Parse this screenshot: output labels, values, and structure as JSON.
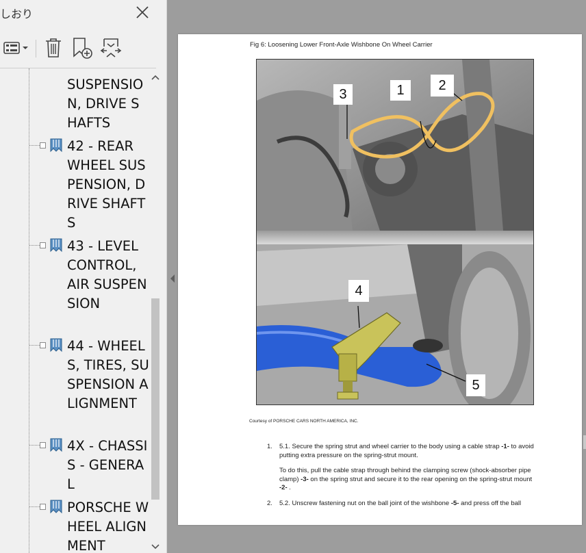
{
  "sidebar": {
    "title": "しおり",
    "toolbar": {
      "options_icon": "options-list-icon",
      "delete_icon": "trash-icon",
      "new_bookmark_icon": "new-bookmark-icon",
      "expand_icon": "expand-bookmark-icon"
    },
    "bookmarks": [
      {
        "label": "SUSPENSION, DRIVE SHAFTS",
        "expanded": false
      },
      {
        "label": "42 - REAR WHEEL SUSPENSION, DRIVE SHAFTS",
        "expanded": false
      },
      {
        "label": "43 - LEVEL CONTROL, AIR SUSPENSION",
        "expanded": false
      },
      {
        "label": "44 - WHEELS, TIRES, SUSPENSION ALIGNMENT",
        "expanded": false
      },
      {
        "label": "4X - CHASSIS - GENERAL",
        "expanded": false
      },
      {
        "label": "PORSCHE WHEEL ALIGNMENT",
        "expanded": false
      }
    ]
  },
  "document": {
    "figure_caption": "Fig 6: Loosening Lower Front-Axle Wishbone On Wheel Carrier",
    "callouts": [
      "1",
      "2",
      "3",
      "4",
      "5"
    ],
    "courtesy": "Courtesy of PORSCHE CARS NORTH AMERICA, INC.",
    "steps": [
      {
        "num": "1.",
        "text_a": "5.1. Secure the spring strut and wheel carrier to the body using a cable strap ",
        "ref_a": "-1-",
        "text_b": " to avoid putting extra pressure on the spring-strut mount.",
        "sub_a": "To do this, pull the cable strap through behind the clamping screw (shock-absorber pipe clamp) ",
        "sub_ref_a": "-3-",
        "sub_b": " on the spring strut and secure it to the rear opening on the spring-strut mount ",
        "sub_ref_b": "-2-",
        "sub_c": " ."
      },
      {
        "num": "2.",
        "text_a": "5.2. Unscrew fastening nut on the ball joint of the wishbone ",
        "ref_a": "-5-",
        "text_b": " and press off the ball"
      }
    ]
  },
  "colors": {
    "sidebar_bg": "#f0f0f0",
    "viewer_bg": "#9d9d9d",
    "bookmark_icon": "#5a8fc2",
    "wishbone_blue": "#2a5fd6",
    "tool_yellow": "#c9c35a",
    "cable_strap": "#f0c060"
  }
}
